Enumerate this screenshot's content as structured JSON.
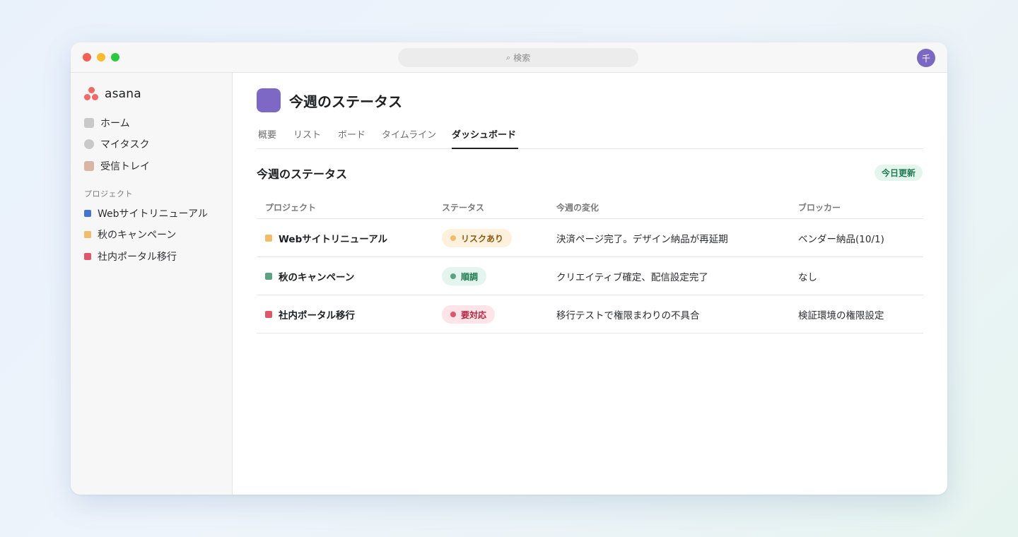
{
  "search": {
    "placeholder": "検索",
    "icon": "search-icon"
  },
  "user": {
    "avatar_initial": "千"
  },
  "sidebar": {
    "logo": "asana",
    "nav": [
      {
        "label": "ホーム",
        "icon": "home-icon"
      },
      {
        "label": "マイタスク",
        "icon": "tasks-icon"
      },
      {
        "label": "受信トレイ",
        "icon": "inbox-icon"
      }
    ],
    "projects_label": "プロジェクト",
    "projects": [
      {
        "label": "Webサイトリニューアル",
        "color": "#4573d2"
      },
      {
        "label": "秋のキャンペーン",
        "color": "#f1bd6c"
      },
      {
        "label": "社内ポータル移行",
        "color": "#e0556a"
      }
    ]
  },
  "header": {
    "title": "今週のステータス",
    "tile_color": "#7e68c6"
  },
  "tabs": [
    {
      "label": "概要",
      "active": false
    },
    {
      "label": "リスト",
      "active": false
    },
    {
      "label": "ボード",
      "active": false
    },
    {
      "label": "タイムライン",
      "active": false
    },
    {
      "label": "ダッシュボード",
      "active": true
    }
  ],
  "card": {
    "title": "今週のステータス",
    "badge": "今日更新",
    "columns": [
      "プロジェクト",
      "ステータス",
      "今週の変化",
      "ブロッカー"
    ],
    "rows": [
      {
        "project": "Webサイトリニューアル",
        "project_color": "#f1bd6c",
        "status": "リスクあり",
        "status_bg": "#fdf0dc",
        "status_fg": "#8a5a10",
        "status_dot": "#f1bd6c",
        "change": "決済ページ完了。デザイン納品が再延期",
        "blocker": "ベンダー納品(10/1)"
      },
      {
        "project": "秋のキャンペーン",
        "project_color": "#5da283",
        "status": "順調",
        "status_bg": "#e3f5ec",
        "status_fg": "#1f7a4f",
        "status_dot": "#5da283",
        "change": "クリエイティブ確定、配信設定完了",
        "blocker": "なし"
      },
      {
        "project": "社内ポータル移行",
        "project_color": "#e0556a",
        "status": "要対応",
        "status_bg": "#fce4e8",
        "status_fg": "#b3263e",
        "status_dot": "#e0556a",
        "change": "移行テストで権限まわりの不具合",
        "blocker": "検証環境の権限設定"
      }
    ]
  }
}
